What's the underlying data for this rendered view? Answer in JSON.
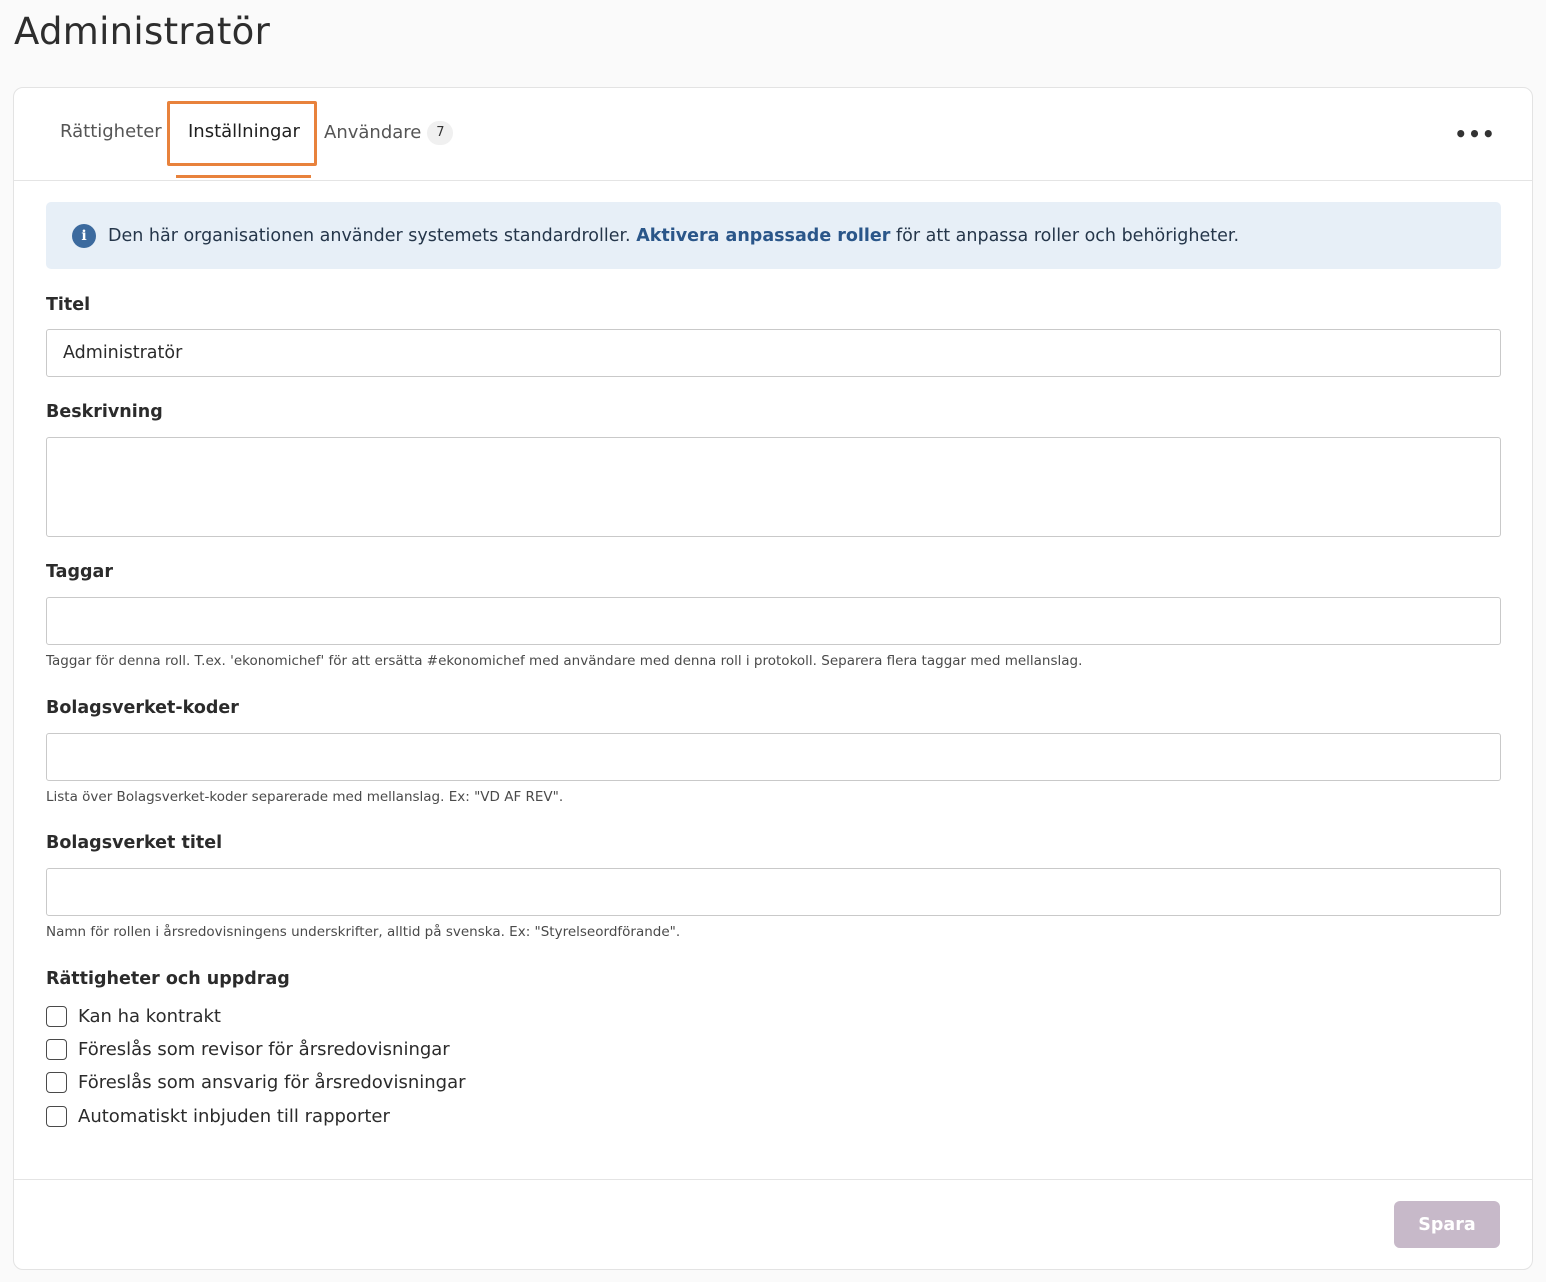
{
  "page": {
    "title": "Administratör"
  },
  "tabs": [
    {
      "label": "Rättigheter"
    },
    {
      "label": "Inställningar"
    },
    {
      "label": "Användare",
      "count": "7"
    }
  ],
  "more_label": "•••",
  "info_banner": {
    "icon_name": "info-icon",
    "text_before": "Den här organisationen använder systemets standardroller.",
    "link": "Aktivera anpassade roller",
    "text_after": "för att anpassa roller och behörigheter."
  },
  "form": {
    "title_label": "Titel",
    "title_value": "Administratör",
    "description_label": "Beskrivning",
    "description_value": "",
    "tags_label": "Taggar",
    "tags_value": "",
    "tags_help": "Taggar för denna roll. T.ex. 'ekonomichef' för att ersätta #ekonomichef med användare med denna roll i protokoll. Separera flera taggar med mellanslag.",
    "bv_codes_label": "Bolagsverket-koder",
    "bv_codes_value": "",
    "bv_codes_help": "Lista över Bolagsverket-koder separerade med mellanslag. Ex: \"VD AF REV\".",
    "bv_title_label": "Bolagsverket titel",
    "bv_title_value": "",
    "bv_title_help": "Namn för rollen i årsredovisningens underskrifter, alltid på svenska. Ex: \"Styrelseordförande\"."
  },
  "rights": {
    "heading": "Rättigheter och uppdrag",
    "options": [
      {
        "label": "Kan ha kontrakt",
        "checked": false
      },
      {
        "label": "Föreslås som revisor för årsredovisningar",
        "checked": false
      },
      {
        "label": "Föreslås som ansvarig för årsredovisningar",
        "checked": false
      },
      {
        "label": "Automatiskt inbjuden till rapporter",
        "checked": false
      }
    ]
  },
  "footer": {
    "save_label": "Spara"
  },
  "colors": {
    "accent": "#e8823c",
    "info_bg": "#e7eff7",
    "link": "#2a5689",
    "save_disabled": "#c7b9c9"
  }
}
